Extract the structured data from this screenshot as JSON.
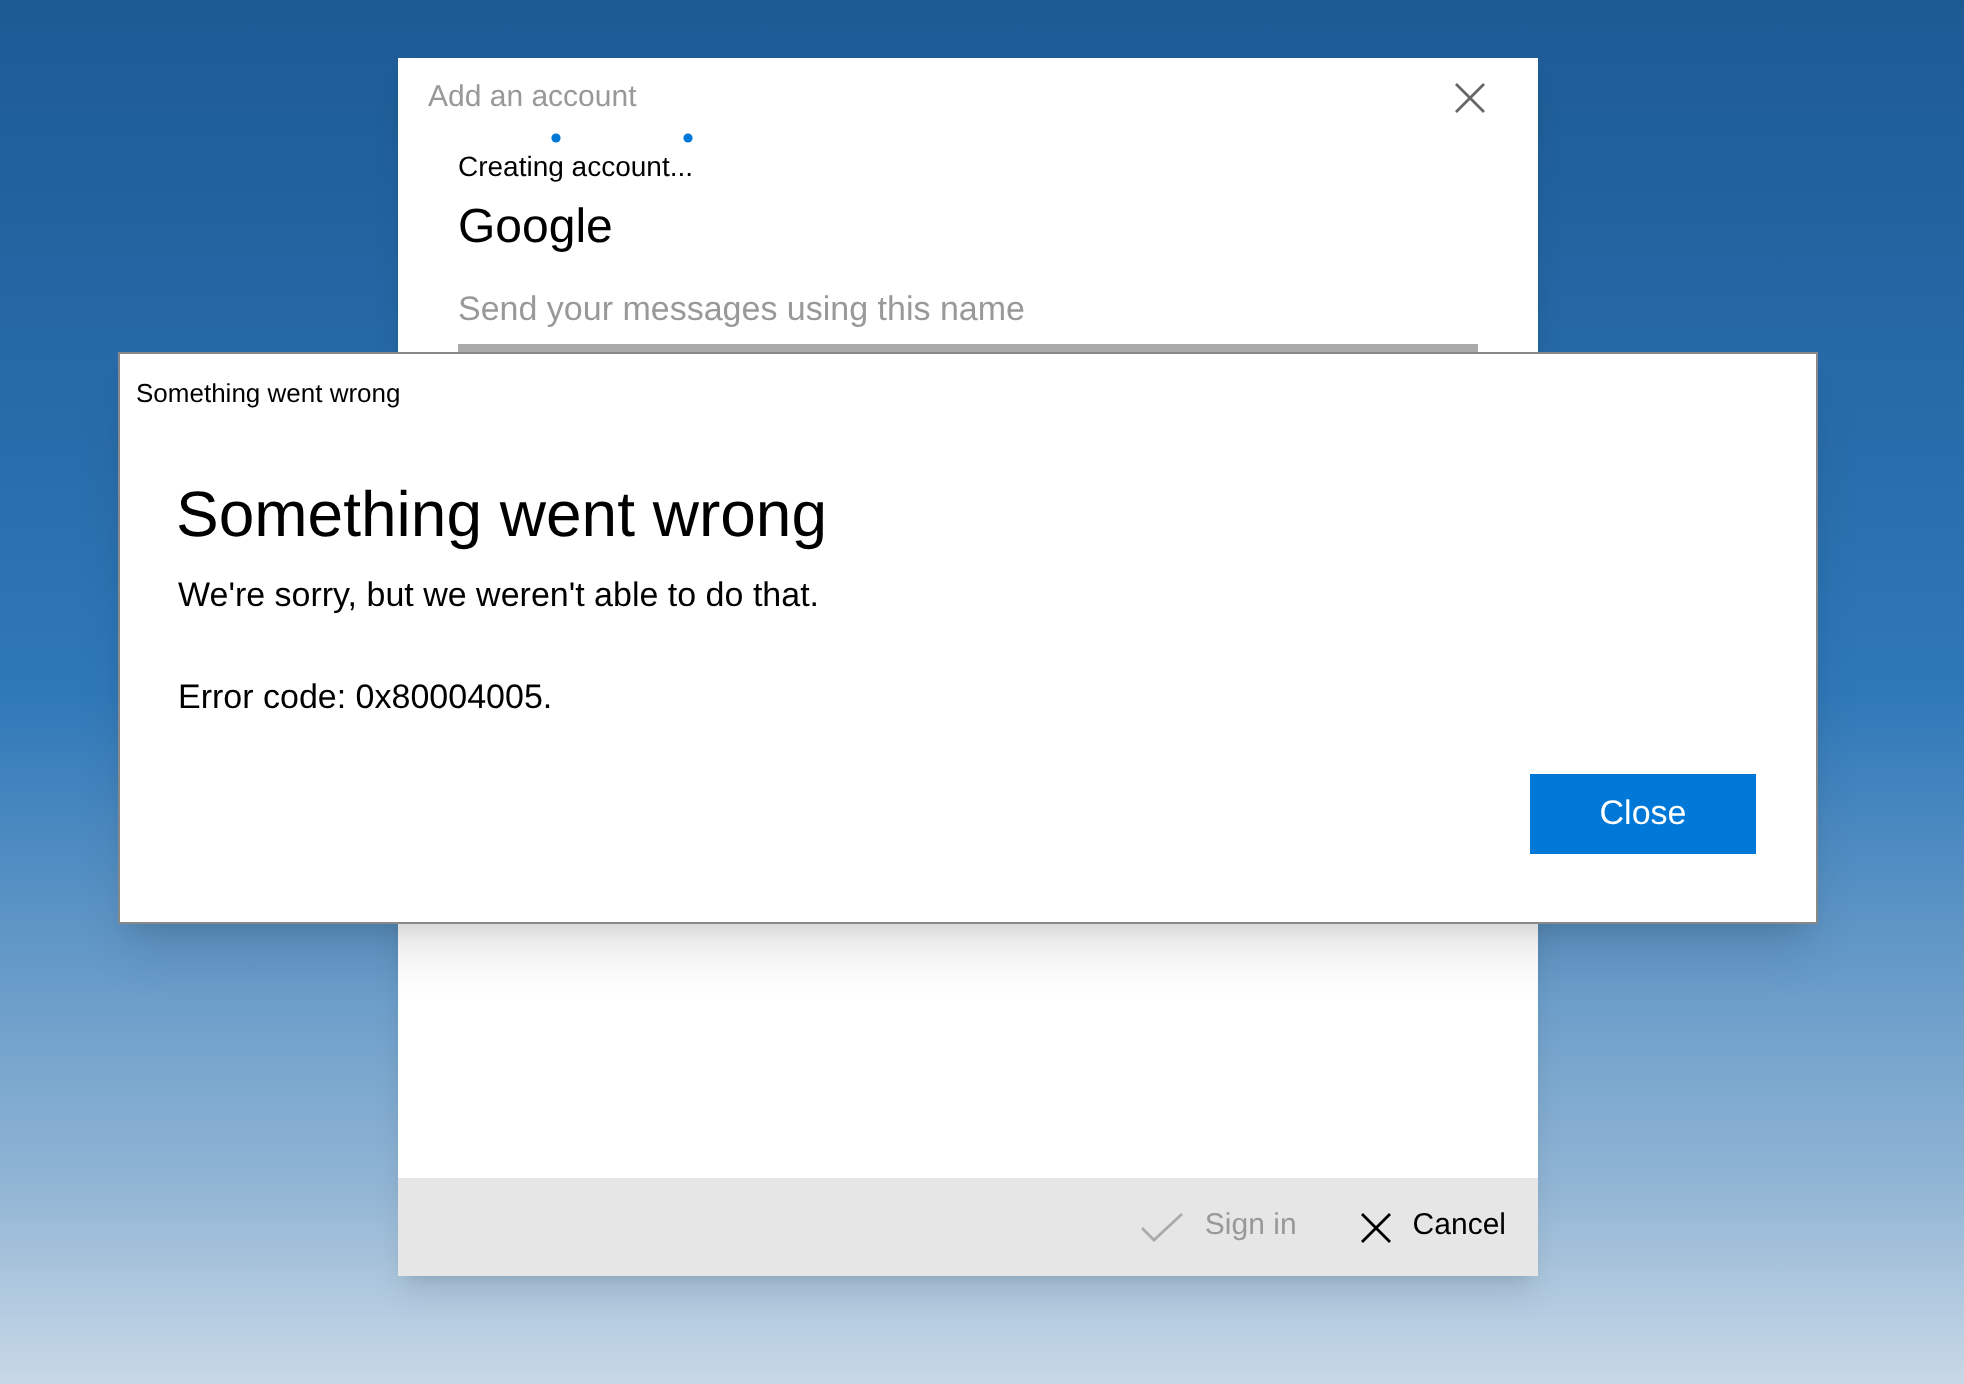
{
  "account_window": {
    "title": "Add an account",
    "status": "Creating account...",
    "provider": "Google",
    "name_field": {
      "placeholder": "Send your messages using this name"
    },
    "buttons": [
      {
        "kind": "sign_in",
        "label": "Sign in",
        "disabled": true
      },
      {
        "kind": "cancel",
        "label": "Cancel",
        "disabled": false
      }
    ]
  },
  "error_dialog": {
    "title": "Something went wrong",
    "heading": "Something went wrong",
    "message": "We're sorry, but we weren't able to do that.",
    "error_code": "Error code: 0x80004005.",
    "button": "Close"
  }
}
